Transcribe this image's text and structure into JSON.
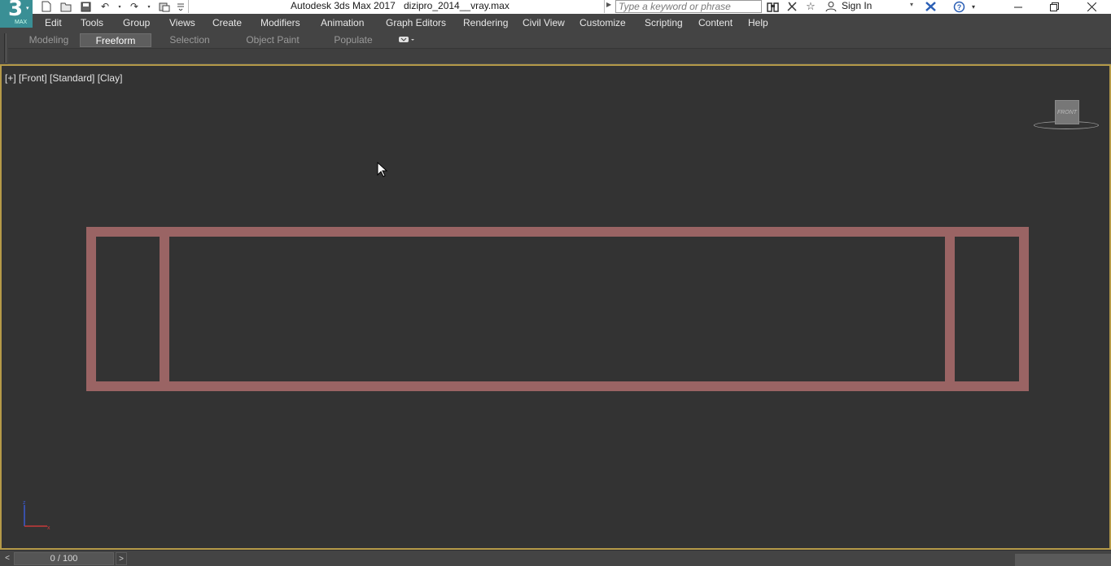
{
  "app": {
    "logo_text": "3",
    "logo_subtext": "MAX",
    "title": "Autodesk 3ds Max 2017",
    "filename": "dizipro_2014__vray.max"
  },
  "search": {
    "placeholder": "Type a keyword or phrase"
  },
  "account": {
    "sign_in": "Sign In"
  },
  "menu": [
    "Edit",
    "Tools",
    "Group",
    "Views",
    "Create",
    "Modifiers",
    "Animation",
    "Graph Editors",
    "Rendering",
    "Civil View",
    "Customize",
    "Scripting",
    "Content",
    "Help"
  ],
  "ribbon": {
    "tabs": [
      "Modeling",
      "Freeform",
      "Selection",
      "Object Paint",
      "Populate"
    ],
    "active_tab": "Freeform"
  },
  "viewport": {
    "label": "[+] [Front] [Standard] [Clay]",
    "viewcube_face": "FRONT",
    "border_color": "#b59a48",
    "background": "#333333",
    "object_color": "#9a6464"
  },
  "timeline": {
    "frame_display": "0 / 100",
    "prev": "<",
    "next": ">"
  },
  "icons": {
    "quick_access": [
      "new-file-icon",
      "open-file-icon",
      "save-icon",
      "undo-icon",
      "redo-icon",
      "project-folder-icon",
      "customize-caret-icon"
    ],
    "toolbar_right": [
      "binoculars-icon",
      "communication-center-icon",
      "favorites-star-icon",
      "user-icon",
      "exchange-apps-icon",
      "help-icon"
    ],
    "window": [
      "minimize-icon",
      "restore-icon",
      "close-icon"
    ]
  }
}
